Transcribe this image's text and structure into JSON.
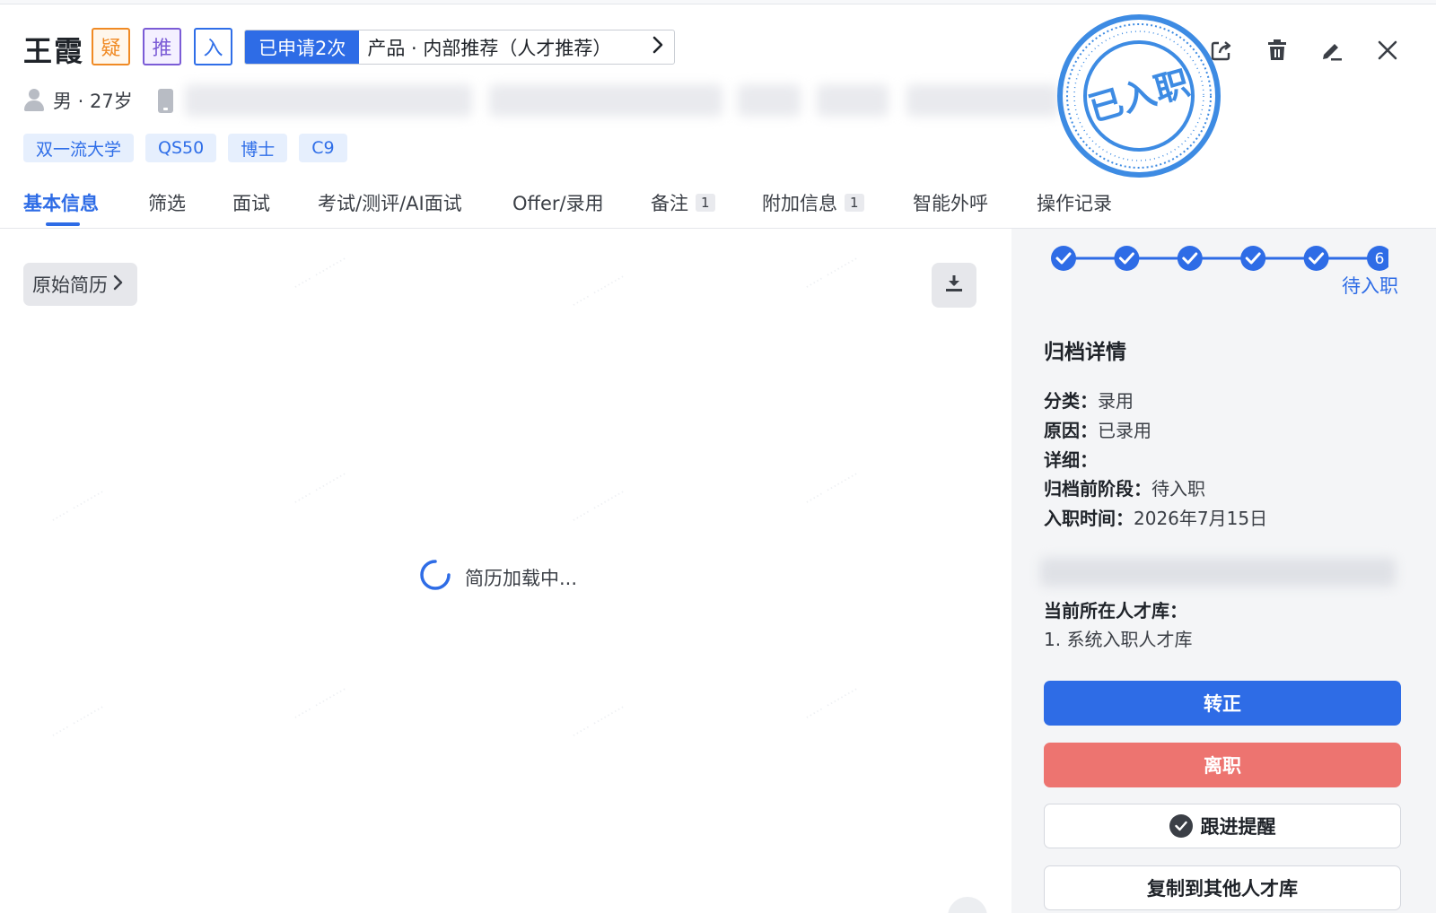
{
  "candidate": {
    "name": "王霞",
    "badges": {
      "doubt": "疑",
      "referral": "推",
      "onboarded": "入"
    },
    "apply_count": "已申请2次",
    "job": "产品 · 内部推荐（人才推荐）",
    "gender_age": "男 · 27岁",
    "tags": [
      "双一流大学",
      "QS50",
      "博士",
      "C9"
    ],
    "stamp_text": "已入职"
  },
  "header_icons": [
    "share-icon",
    "trash-icon",
    "edit-icon",
    "close-icon"
  ],
  "tabs": [
    {
      "label": "基本信息",
      "active": true
    },
    {
      "label": "筛选"
    },
    {
      "label": "面试"
    },
    {
      "label": "考试/测评/AI面试"
    },
    {
      "label": "Offer/录用"
    },
    {
      "label": "备注",
      "count": "1"
    },
    {
      "label": "附加信息",
      "count": "1"
    },
    {
      "label": "智能外呼"
    },
    {
      "label": "操作记录"
    }
  ],
  "resume": {
    "original_label": "原始简历",
    "loading_text": "简历加载中..."
  },
  "progress": {
    "completed_steps": 5,
    "current_step": "6",
    "current_status": "待入职"
  },
  "archive": {
    "title": "归档详情",
    "category_label": "分类：",
    "category_value": "录用",
    "reason_label": "原因：",
    "reason_value": "已录用",
    "detail_label": "详细：",
    "prev_stage_label": "归档前阶段：",
    "prev_stage_value": "待入职",
    "onboard_label": "入职时间：",
    "onboard_value": "2026年7月15日"
  },
  "talent_pool": {
    "title": "当前所在人才库：",
    "item": "1. 系统入职人才库"
  },
  "actions": {
    "regularize": "转正",
    "resign": "离职",
    "remind": "跟进提醒",
    "copy_pool": "复制到其他人才库"
  },
  "colors": {
    "primary": "#2e6ce6",
    "danger": "#ed7470",
    "doubt": "#f08a24",
    "referral": "#7b5cd6"
  }
}
